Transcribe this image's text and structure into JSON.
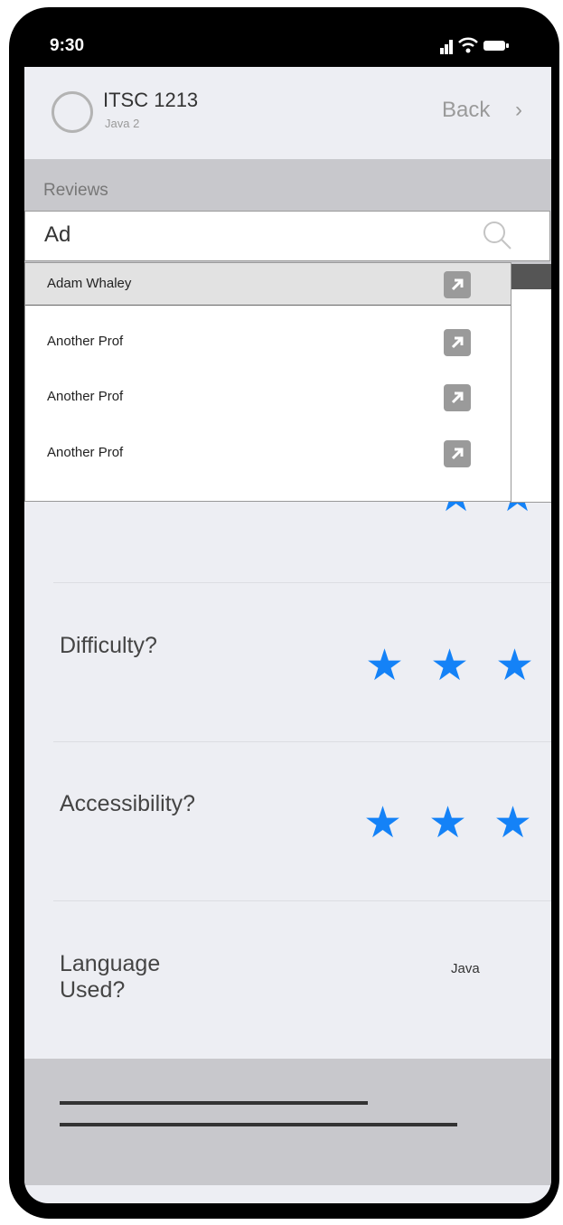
{
  "status_bar": {
    "time": "9:30"
  },
  "header": {
    "title": "ITSC 1213",
    "subtitle": "Java 2",
    "back_label": "Back",
    "back_chevron": "›"
  },
  "section": {
    "label": "Reviews"
  },
  "search": {
    "value": "Ad",
    "icon": "search-icon"
  },
  "dropdown": {
    "items": [
      {
        "label": "Adam Whaley",
        "icon": "external-link-icon"
      },
      {
        "label": "Another Prof",
        "icon": "external-link-icon"
      },
      {
        "label": "Another Prof",
        "icon": "external-link-icon"
      },
      {
        "label": "Another Prof",
        "icon": "external-link-icon"
      }
    ]
  },
  "ratings": [
    {
      "label": "Difficulty?"
    },
    {
      "label": "Accessibility?"
    }
  ],
  "language": {
    "label_line1": "Language",
    "label_line2": "Used?",
    "value": "Java"
  },
  "colors": {
    "star": "#1482f7",
    "band": "#c8c8cc",
    "background": "#edeef3"
  }
}
